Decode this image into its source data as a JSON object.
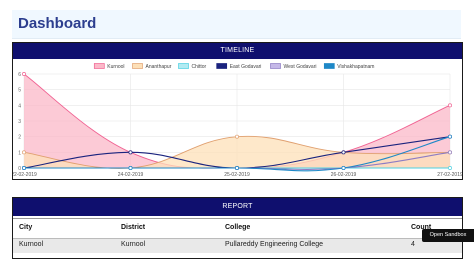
{
  "page": {
    "title": "Dashboard"
  },
  "timeline": {
    "title": "TIMELINE"
  },
  "chart_data": {
    "type": "area",
    "categories": [
      "22-02-2019",
      "24-02-2019",
      "25-02-2019",
      "26-02-2019",
      "27-02-2019"
    ],
    "ylim": [
      0,
      6
    ],
    "yticks": [
      0,
      1,
      2,
      3,
      4,
      5,
      6
    ],
    "grid": true,
    "legend_position": "top",
    "series": [
      {
        "name": "Kurnool",
        "values": [
          6,
          1,
          0,
          1,
          4
        ],
        "stroke": "#f06292",
        "fill": "#fbb8c8",
        "filled": true
      },
      {
        "name": "Ananthapur",
        "values": [
          1,
          0,
          2,
          1,
          1
        ],
        "stroke": "#e0a070",
        "fill": "#fde0b8",
        "filled": true
      },
      {
        "name": "Chittor",
        "values": [
          0,
          0,
          0,
          0,
          0
        ],
        "stroke": "#4dd0e1",
        "fill": "#b2ebf2",
        "filled": false
      },
      {
        "name": "East Godavari",
        "values": [
          0,
          1,
          0,
          1,
          2
        ],
        "stroke": "#1a237e",
        "fill": "#1a237e",
        "filled": false
      },
      {
        "name": "West Godavari",
        "values": [
          0,
          0,
          0,
          0,
          1
        ],
        "stroke": "#8e7cc3",
        "fill": "#c5b8e8",
        "filled": false
      },
      {
        "name": "Vishakhapatnam",
        "values": [
          0,
          0,
          0,
          0,
          2
        ],
        "stroke": "#1e88c7",
        "fill": "#1e88c7",
        "filled": false
      }
    ]
  },
  "report": {
    "title": "REPORT",
    "columns": [
      "City",
      "District",
      "College",
      "Count"
    ],
    "rows": [
      [
        "Kurnool",
        "Kurnool",
        "Pullareddy Engineering College",
        "4"
      ]
    ]
  },
  "sandbox_button": "Open Sandbox"
}
